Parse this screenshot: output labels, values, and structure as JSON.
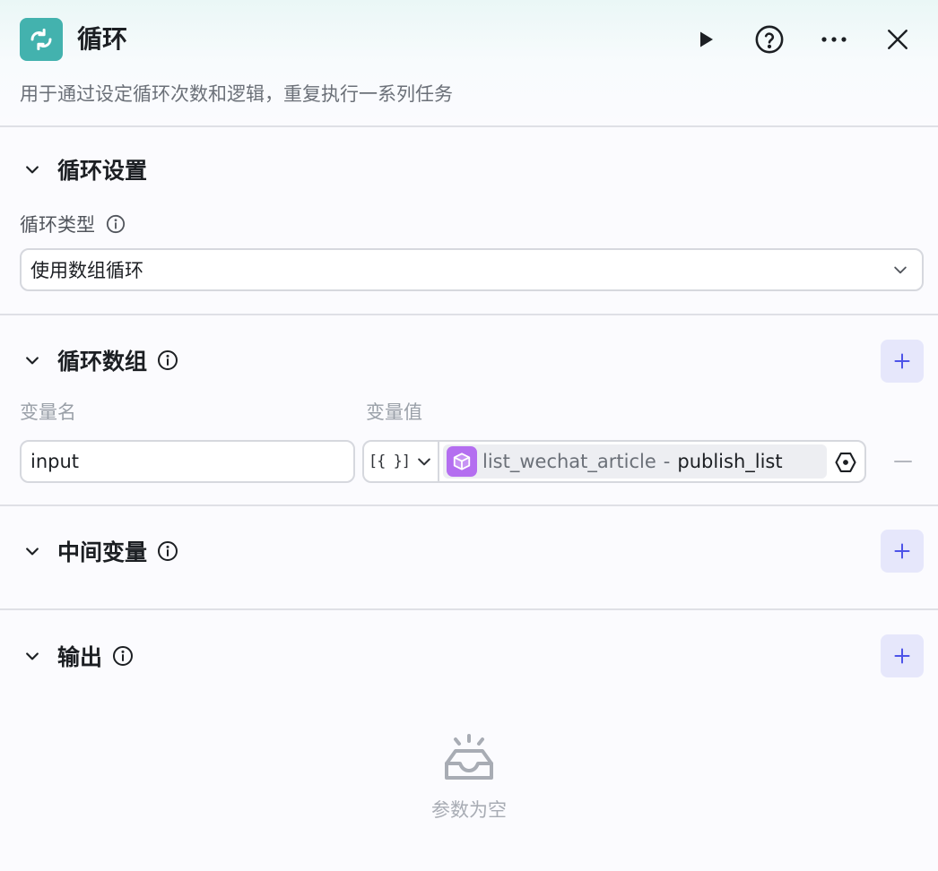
{
  "node": {
    "title": "循环",
    "description": "用于通过设定循环次数和逻辑，重复执行一系列任务",
    "icon": "loop-icon",
    "accent": "#43b2ae"
  },
  "header_actions": {
    "run": "play-icon",
    "help": "help-circle-icon",
    "more": "more-icon",
    "close": "close-icon"
  },
  "loop_settings": {
    "title": "循环设置",
    "type_label": "循环类型",
    "type_value": "使用数组循环"
  },
  "loop_array": {
    "title": "循环数组",
    "col_name": "变量名",
    "col_value": "变量值",
    "rows": [
      {
        "name": "input",
        "type_glyph": "[{ }]",
        "ref_source": "list_wechat_article",
        "ref_sep": "-",
        "ref_field": "publish_list"
      }
    ]
  },
  "intermediate_vars": {
    "title": "中间变量"
  },
  "output": {
    "title": "输出",
    "empty_text": "参数为空"
  },
  "colors": {
    "add_button_bg": "#e6e7fb",
    "add_button_fg": "#4d53e8",
    "ref_icon_bg": "#b46ef0"
  }
}
